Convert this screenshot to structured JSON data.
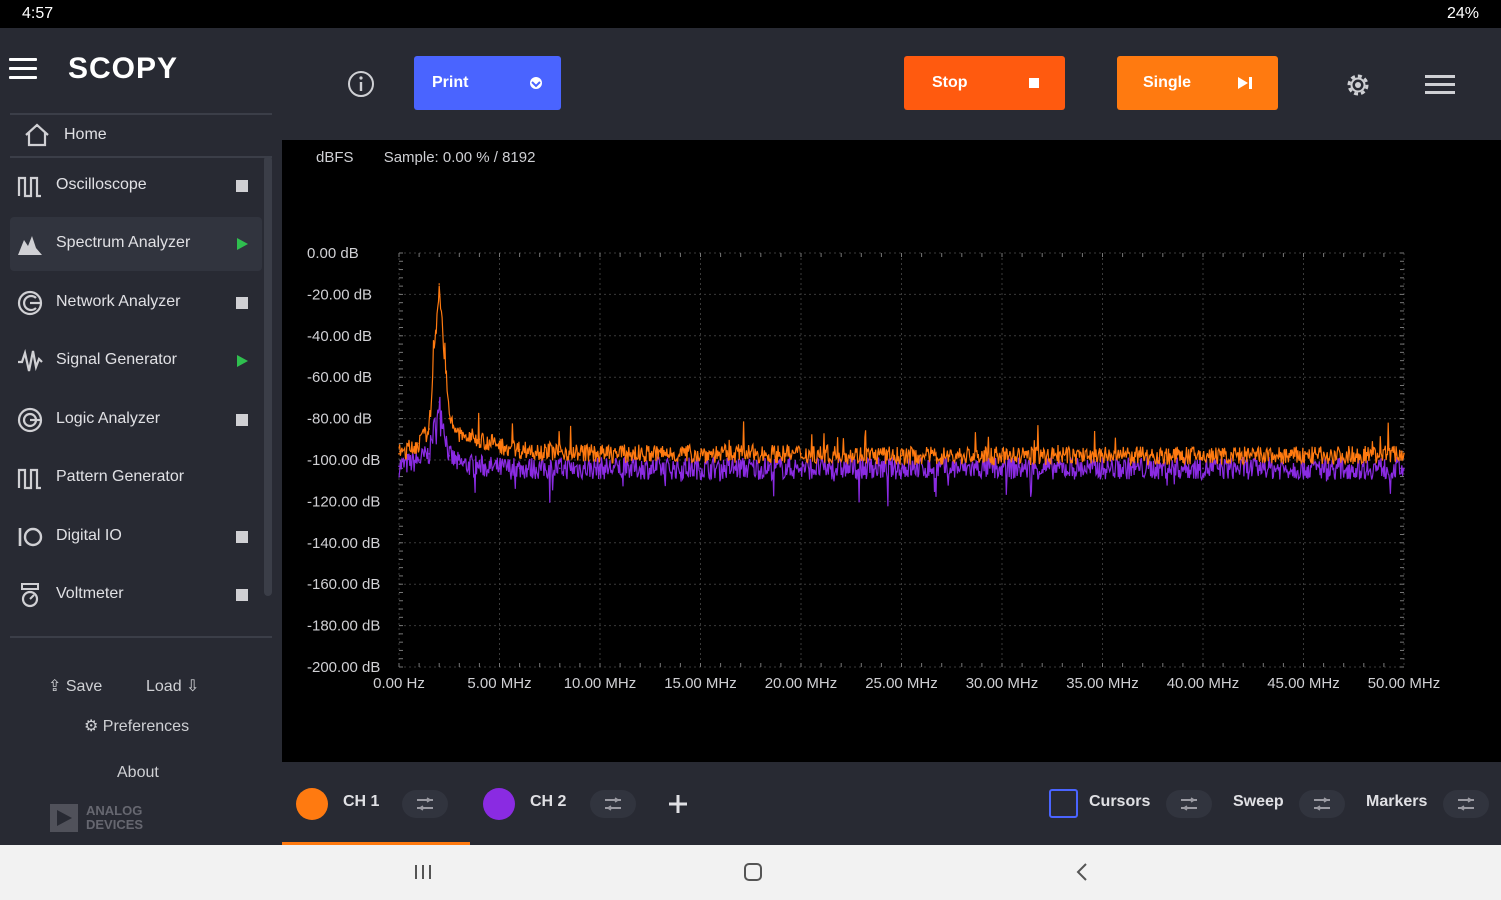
{
  "status_bar": {
    "time": "4:57",
    "battery": "24%"
  },
  "sidebar": {
    "brand": "SCOPY",
    "home_label": "Home",
    "tools": [
      {
        "label": "Oscilloscope",
        "icon": "oscilloscope-icon",
        "state": "stopped"
      },
      {
        "label": "Spectrum Analyzer",
        "icon": "spectrum-icon",
        "state": "running"
      },
      {
        "label": "Network Analyzer",
        "icon": "network-icon",
        "state": "stopped"
      },
      {
        "label": "Signal Generator",
        "icon": "signal-icon",
        "state": "running"
      },
      {
        "label": "Logic Analyzer",
        "icon": "logic-icon",
        "state": "stopped"
      },
      {
        "label": "Pattern Generator",
        "icon": "pattern-icon",
        "state": "none"
      },
      {
        "label": "Digital IO",
        "icon": "digital-io-icon",
        "state": "stopped"
      },
      {
        "label": "Voltmeter",
        "icon": "voltmeter-icon",
        "state": "stopped"
      }
    ],
    "save_label": "Save",
    "load_label": "Load",
    "preferences_label": "Preferences",
    "about_label": "About",
    "logo_text": "ANALOG DEVICES"
  },
  "toolbar": {
    "print_label": "Print",
    "stop_label": "Stop",
    "single_label": "Single"
  },
  "plot": {
    "unit_label": "dBFS",
    "sample_label": "Sample: 0.00 % / 8192"
  },
  "colors": {
    "ch1": "#ff7a10",
    "ch2": "#8a2be2",
    "accent_blue": "#4a64ff",
    "stop": "#ff5a0f",
    "single": "#ff7a10"
  },
  "chart_data": {
    "type": "line",
    "ylim": [
      -200,
      0
    ],
    "xlim": [
      0,
      50
    ],
    "y_ticks": [
      "0.00 dB",
      "-20.00 dB",
      "-40.00 dB",
      "-60.00 dB",
      "-80.00 dB",
      "-100.00 dB",
      "-120.00 dB",
      "-140.00 dB",
      "-160.00 dB",
      "-180.00 dB",
      "-200.00 dB"
    ],
    "x_ticks": [
      "0.00 Hz",
      "5.00 MHz",
      "10.00 MHz",
      "15.00 MHz",
      "20.00 MHz",
      "25.00 MHz",
      "30.00 MHz",
      "35.00 MHz",
      "40.00 MHz",
      "45.00 MHz",
      "50.00 MHz"
    ],
    "grid": true,
    "series": [
      {
        "name": "CH 1",
        "color": "#ff7a10",
        "x": [
          0,
          1,
          1.5,
          2,
          2.5,
          3,
          4,
          5,
          6,
          8,
          10,
          15,
          20,
          25,
          30,
          35,
          40,
          45,
          50
        ],
        "values": [
          -97,
          -92,
          -85,
          -15,
          -80,
          -88,
          -90,
          -93,
          -95,
          -96,
          -97,
          -97,
          -97,
          -98,
          -98,
          -98,
          -98,
          -98,
          -97
        ]
      },
      {
        "name": "CH 2",
        "color": "#8a2be2",
        "x": [
          0,
          1,
          1.5,
          2,
          2.5,
          3,
          4,
          5,
          6,
          8,
          10,
          15,
          20,
          25,
          30,
          35,
          40,
          45,
          50
        ],
        "values": [
          -103,
          -100,
          -97,
          -72,
          -98,
          -102,
          -103,
          -104,
          -104,
          -104,
          -104,
          -104,
          -104,
          -104,
          -104,
          -104,
          -104,
          -104,
          -104
        ]
      }
    ]
  },
  "bottom_bar": {
    "ch1_label": "CH 1",
    "ch2_label": "CH 2",
    "cursors_label": "Cursors",
    "sweep_label": "Sweep",
    "markers_label": "Markers"
  }
}
